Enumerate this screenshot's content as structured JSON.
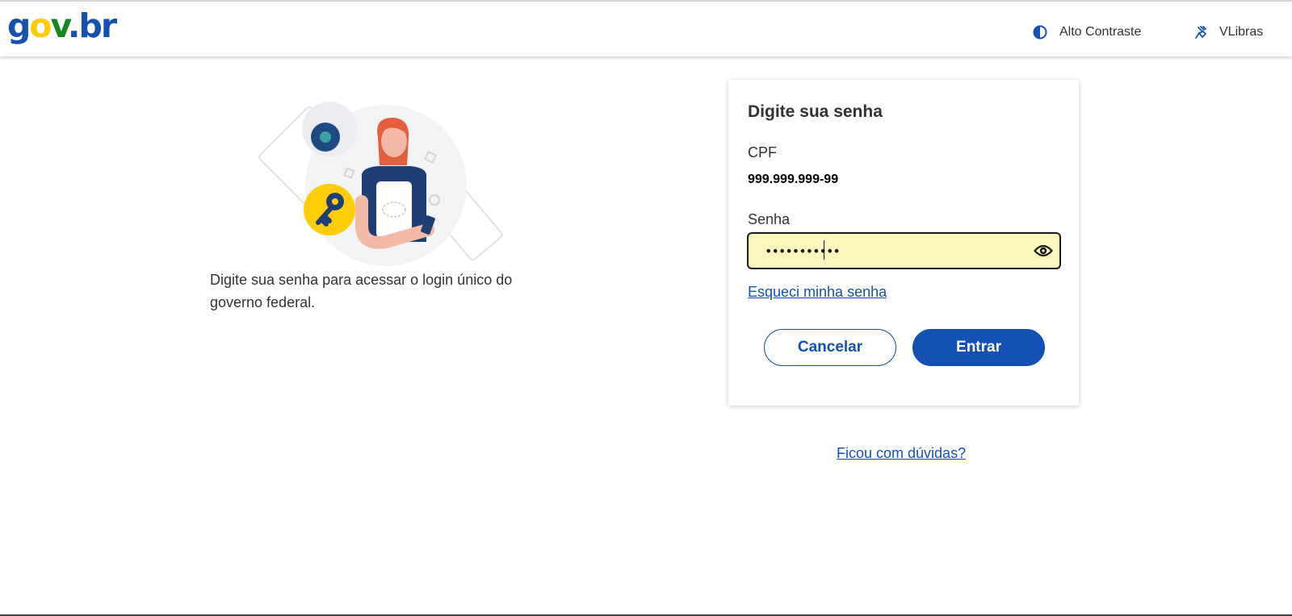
{
  "header": {
    "logo": {
      "g": "g",
      "o": "o",
      "v": "v",
      "dot": ".",
      "br": "br",
      "full": "gov.br"
    },
    "contrast_label": "Alto Contraste",
    "vlibras_label": "VLibras"
  },
  "intro": {
    "text": "Digite sua senha para acessar o login único do governo federal."
  },
  "card": {
    "title": "Digite sua senha",
    "cpf_label": "CPF",
    "cpf_value": "999.999.999-99",
    "senha_label": "Senha",
    "password_value": "•••••••••••",
    "forgot_link": "Esqueci minha senha",
    "cancel_label": "Cancelar",
    "enter_label": "Entrar"
  },
  "help_link": "Ficou com dúvidas?",
  "colors": {
    "brand_blue": "#1351b4",
    "brand_yellow": "#ffcd07",
    "brand_green": "#168821",
    "input_highlight": "#fcf7bd"
  },
  "icons": {
    "contrast": "contrast-icon",
    "vlibras": "vlibras-hand-icon",
    "eye": "eye-icon"
  }
}
